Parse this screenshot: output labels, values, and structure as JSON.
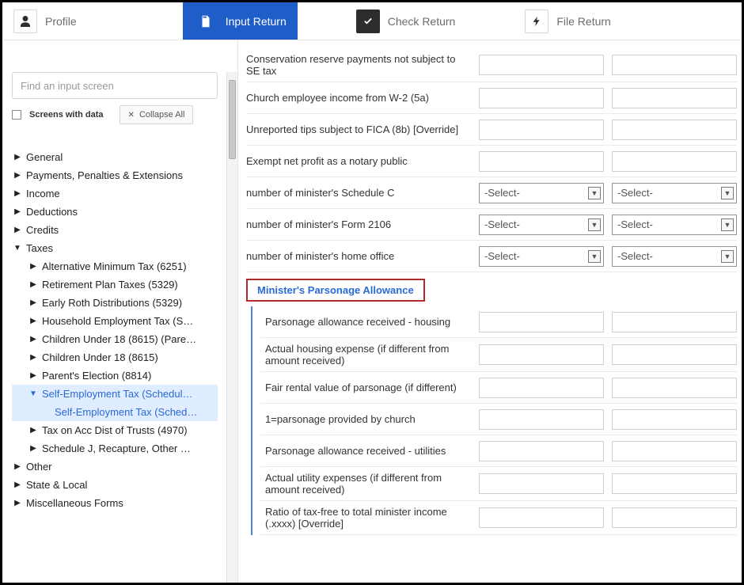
{
  "tabs": {
    "profile": "Profile",
    "input_return": "Input Return",
    "check_return": "Check Return",
    "file_return": "File Return"
  },
  "sidebar": {
    "search_placeholder": "Find an input screen",
    "screens_with_data": "Screens with data",
    "collapse_all": "Collapse All",
    "items": [
      {
        "label": "General",
        "level": 1,
        "expanded": false
      },
      {
        "label": "Payments, Penalties & Extensions",
        "level": 1,
        "expanded": false
      },
      {
        "label": "Income",
        "level": 1,
        "expanded": false
      },
      {
        "label": "Deductions",
        "level": 1,
        "expanded": false
      },
      {
        "label": "Credits",
        "level": 1,
        "expanded": false
      },
      {
        "label": "Taxes",
        "level": 1,
        "expanded": true
      },
      {
        "label": "Alternative Minimum Tax (6251)",
        "level": 2,
        "expanded": false
      },
      {
        "label": "Retirement Plan Taxes (5329)",
        "level": 2,
        "expanded": false
      },
      {
        "label": "Early Roth Distributions (5329)",
        "level": 2,
        "expanded": false
      },
      {
        "label": "Household Employment Tax (S…",
        "level": 2,
        "expanded": false
      },
      {
        "label": "Children Under 18 (8615) (Pare…",
        "level": 2,
        "expanded": false
      },
      {
        "label": "Children Under 18 (8615)",
        "level": 2,
        "expanded": false
      },
      {
        "label": "Parent's Election (8814)",
        "level": 2,
        "expanded": false
      },
      {
        "label": "Self-Employment Tax (Schedul…",
        "level": 2,
        "expanded": true,
        "selected": true
      },
      {
        "label": "Self-Employment Tax (Sched…",
        "level": 3,
        "selected_child": true
      },
      {
        "label": "Tax on Acc Dist of Trusts (4970)",
        "level": 2,
        "expanded": false
      },
      {
        "label": "Schedule J, Recapture, Other …",
        "level": 2,
        "expanded": false
      },
      {
        "label": "Other",
        "level": 1,
        "expanded": false
      },
      {
        "label": "State & Local",
        "level": 1,
        "expanded": false
      },
      {
        "label": "Miscellaneous Forms",
        "level": 1,
        "expanded": false
      }
    ]
  },
  "form": {
    "select_placeholder": "-Select-",
    "rows_top": [
      {
        "label": "Conservation reserve payments not subject to SE tax",
        "type": "text"
      },
      {
        "label": "Church employee income from W-2 (5a)",
        "type": "text"
      },
      {
        "label": "Unreported tips subject to FICA (8b) [Override]",
        "type": "text"
      },
      {
        "label": "Exempt net profit as a notary public",
        "type": "text"
      },
      {
        "label": "number of minister's Schedule C",
        "type": "select"
      },
      {
        "label": "number of minister's Form 2106",
        "type": "select"
      },
      {
        "label": "number of minister's home office",
        "type": "select"
      }
    ],
    "section_heading": "Minister's Parsonage Allowance",
    "rows_sub": [
      {
        "label": "Parsonage allowance received - housing"
      },
      {
        "label": "Actual housing expense (if different from amount received)"
      },
      {
        "label": "Fair rental value of parsonage (if different)"
      },
      {
        "label": "1=parsonage provided by church"
      },
      {
        "label": "Parsonage allowance received - utilities"
      },
      {
        "label": "Actual utility expenses (if different from amount received)"
      },
      {
        "label": "Ratio of tax-free to total minister income (.xxxx) [Override]"
      }
    ]
  }
}
